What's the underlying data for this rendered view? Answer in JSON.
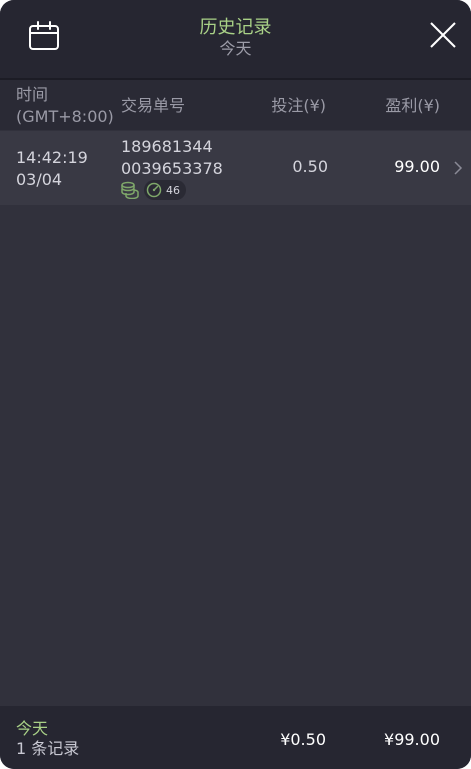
{
  "header": {
    "title": "历史记录",
    "subtitle": "今天",
    "calendar_icon": "calendar-icon",
    "close_icon": "close-icon"
  },
  "columns": {
    "time_line1": "时间",
    "time_line2": "(GMT+8:00)",
    "order": "交易单号",
    "bet": "投注(¥)",
    "profit": "盈利(¥)"
  },
  "rows": [
    {
      "time": "14:42:19",
      "date": "03/04",
      "order_line1": "189681344",
      "order_line2": "0039653378",
      "tag_icon": "coins-icon",
      "badge_icon": "gauge-icon",
      "badge_value": "46",
      "bet": "0.50",
      "profit": "99.00"
    }
  ],
  "footer": {
    "label": "今天",
    "count": "1 条记录",
    "total_bet": "¥0.50",
    "total_profit": "¥99.00"
  },
  "colors": {
    "accent": "#a9d187",
    "background": "#31313c",
    "header": "#262631",
    "row": "#393944"
  }
}
